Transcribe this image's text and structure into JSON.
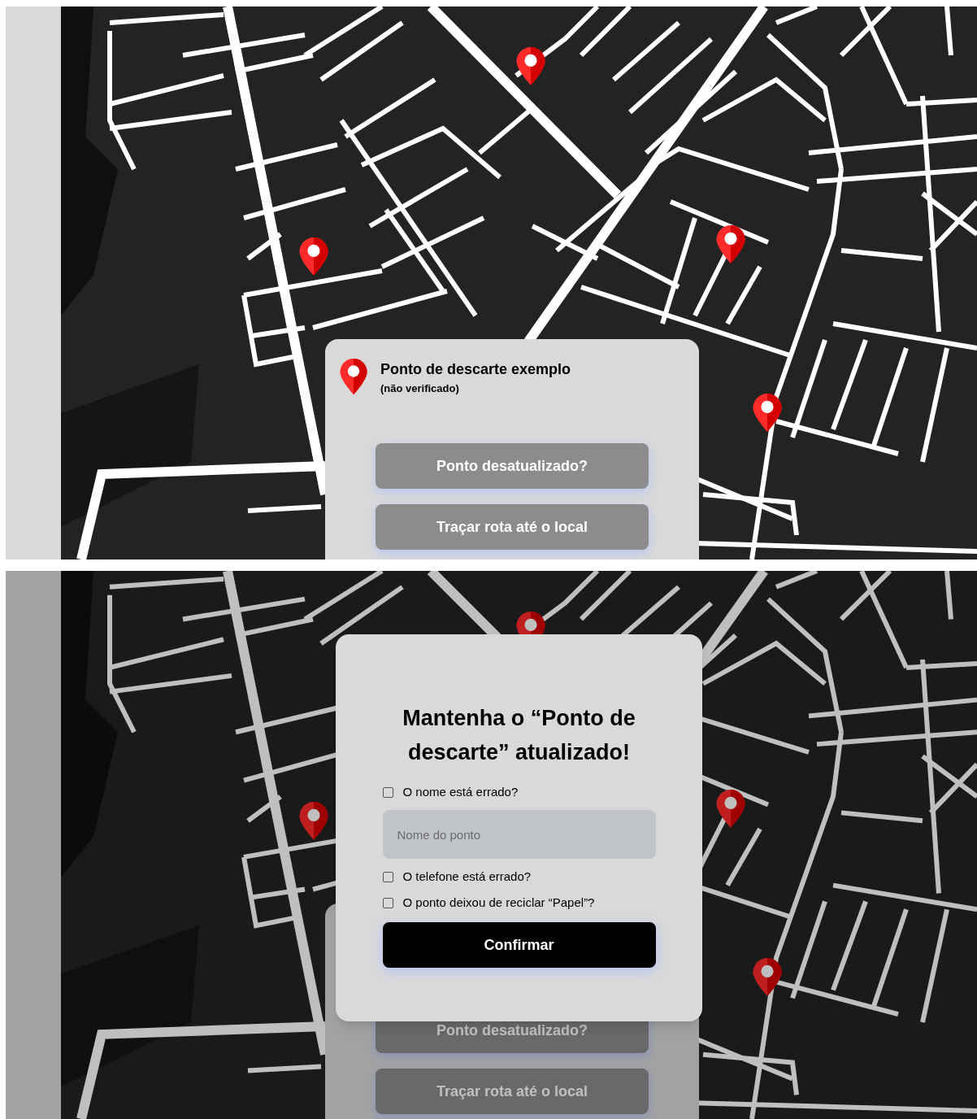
{
  "screens": [
    {
      "kind": "detail",
      "dimmed": false,
      "card": {
        "title": "Ponto de descarte exemplo",
        "subtitle": "(não verificado)",
        "buttons": [
          "Ponto desatualizado?",
          "Traçar rota até o local"
        ]
      }
    },
    {
      "kind": "report",
      "dimmed": true,
      "card": {
        "buttons": [
          "Ponto desatualizado?",
          "Traçar rota até o local"
        ]
      },
      "dialog": {
        "title": "Mantenha o “Ponto de descarte” atualizado!",
        "items": [
          {
            "kind": "checkbox",
            "label": "O nome está errado?",
            "checked": false
          },
          {
            "kind": "field",
            "placeholder": "Nome do ponto"
          },
          {
            "kind": "checkbox",
            "label": "O telefone está errado?",
            "checked": false
          },
          {
            "kind": "checkbox",
            "label": "O ponto deixou de reciclar “Papel”?",
            "checked": false
          }
        ],
        "confirm": "Confirmar"
      }
    }
  ]
}
